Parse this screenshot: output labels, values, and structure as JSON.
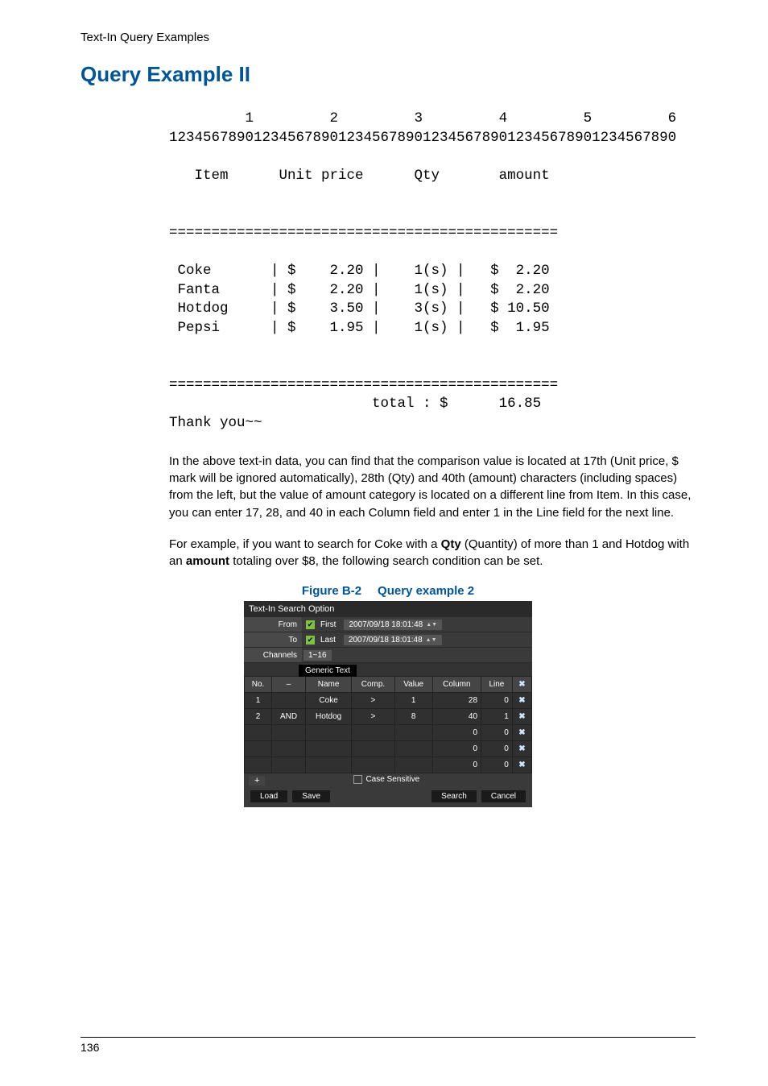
{
  "header": {
    "section": "Text-In Query Examples"
  },
  "heading": "Query Example II",
  "receipt": {
    "ruler_tens": "         1         2         3         4         5         6",
    "ruler_ones": "123456789012345678901234567890123456789012345678901234567890",
    "cols_line": "   Item      Unit price      Qty       amount",
    "sep": "==============================================",
    "lines": [
      " Coke       | $    2.20 |    1(s) |   $  2.20",
      " Fanta      | $    2.20 |    1(s) |   $  2.20",
      " Hotdog     | $    3.50 |    3(s) |   $ 10.50",
      " Pepsi      | $    1.95 |    1(s) |   $  1.95"
    ],
    "total_line": "                        total : $      16.85",
    "thanks": "Thank you~~"
  },
  "body": {
    "p1": "In the above text-in data, you can find that the comparison value is located at 17th (Unit price, $ mark will be ignored automatically), 28th (Qty) and 40th (amount) characters (including spaces) from the left, but the value of amount category is located on a different line from Item. In this case, you can enter 17, 28, and 40 in each Column field and enter 1 in the Line field for the next line.",
    "p2a": "For example, if you want to search for Coke with a ",
    "p2_b1": "Qty",
    "p2b": " (Quantity) of more than 1 and Hotdog with an ",
    "p2_b2": "amount",
    "p2c": " totaling over $8, the following search condition can be set."
  },
  "figure": {
    "label": "Figure B-2",
    "title": "Query example 2"
  },
  "dialog": {
    "title": "Text-In Search Option",
    "from_label": "From",
    "to_label": "To",
    "channels_label": "Channels",
    "first_chk": "First",
    "last_chk": "Last",
    "from_dt": "2007/09/18 18:01:48",
    "to_dt": "2007/09/18 18:01:48",
    "channels_val": "1~16",
    "generic_tab": "Generic Text",
    "headers": [
      "No.",
      "–",
      "Name",
      "Comp.",
      "Value",
      "Column",
      "Line",
      "✖"
    ],
    "rows": [
      {
        "no": "1",
        "op": "",
        "name": "Coke",
        "comp": ">",
        "value": "1",
        "column": "28",
        "line": "0",
        "del": "✖"
      },
      {
        "no": "2",
        "op": "AND",
        "name": "Hotdog",
        "comp": ">",
        "value": "8",
        "column": "40",
        "line": "1",
        "del": "✖"
      },
      {
        "no": "",
        "op": "",
        "name": "",
        "comp": "",
        "value": "",
        "column": "0",
        "line": "0",
        "del": "✖"
      },
      {
        "no": "",
        "op": "",
        "name": "",
        "comp": "",
        "value": "",
        "column": "0",
        "line": "0",
        "del": "✖"
      },
      {
        "no": "",
        "op": "",
        "name": "",
        "comp": "",
        "value": "",
        "column": "0",
        "line": "0",
        "del": "✖"
      }
    ],
    "add": "+",
    "case_sensitive": "Case Sensitive",
    "btn_load": "Load",
    "btn_save": "Save",
    "btn_search": "Search",
    "btn_cancel": "Cancel"
  },
  "footer": {
    "page": "136"
  }
}
